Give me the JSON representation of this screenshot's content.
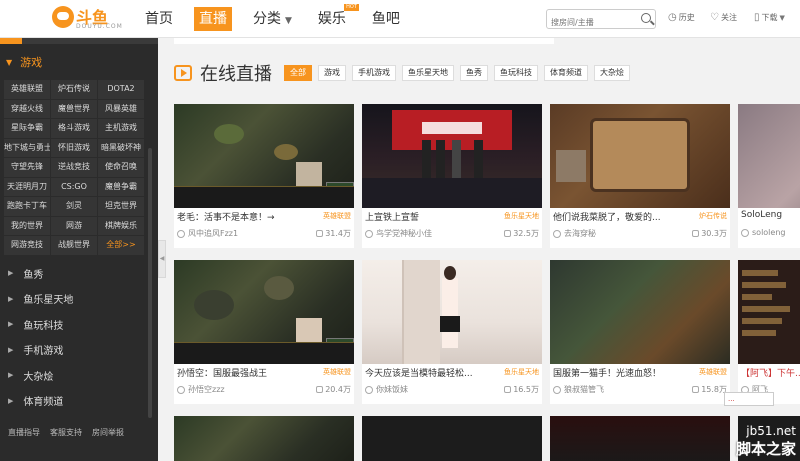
{
  "logo": {
    "brand": "斗鱼",
    "sub": "DOUYU.COM"
  },
  "nav": {
    "items": [
      {
        "label": "首页",
        "active": false
      },
      {
        "label": "直播",
        "active": true
      },
      {
        "label": "分类",
        "active": false,
        "has_caret": true
      },
      {
        "label": "娱乐",
        "active": false,
        "badge": "HOT"
      },
      {
        "label": "鱼吧",
        "active": false
      }
    ]
  },
  "search": {
    "placeholder": "搜房间/主播"
  },
  "header_utils": {
    "history": "历史",
    "follow": "关注",
    "download": "下载"
  },
  "sidebar": {
    "games_label": "游戏",
    "games": [
      "英雄联盟",
      "炉石传说",
      "DOTA2",
      "穿越火线",
      "魔兽世界",
      "风暴英雄",
      "星际争霸",
      "格斗游戏",
      "主机游戏",
      "地下城与勇士",
      "怀旧游戏",
      "暗黑破坏神",
      "守望先锋",
      "逆战竞技",
      "使命召唤",
      "天涯明月刀",
      "CS:GO",
      "魔兽争霸",
      "跑跑卡丁车",
      "剑灵",
      "坦克世界",
      "我的世界",
      "网游",
      "棋牌娱乐",
      "网游竞技",
      "战舰世界",
      "全部>>"
    ],
    "categories": [
      "鱼秀",
      "鱼乐星天地",
      "鱼玩科技",
      "手机游戏",
      "大杂烩",
      "体育频道"
    ],
    "footer": [
      "直播指导",
      "客服支持",
      "房间举报"
    ]
  },
  "main": {
    "section_title": "在线直播",
    "tags": [
      {
        "label": "全部",
        "active": true
      },
      {
        "label": "游戏",
        "active": false
      },
      {
        "label": "手机游戏",
        "active": false
      },
      {
        "label": "鱼乐星天地",
        "active": false
      },
      {
        "label": "鱼秀",
        "active": false
      },
      {
        "label": "鱼玩科技",
        "active": false
      },
      {
        "label": "体育频道",
        "active": false
      },
      {
        "label": "大杂烩",
        "active": false
      }
    ],
    "cards": [
      {
        "title": "老毛：活事不是本意！→",
        "category": "英雄联盟",
        "anchor": "风中追风Fzz1",
        "viewers": "31.4万"
      },
      {
        "title": "上宣铁上宣誓",
        "category": "鱼乐星天地",
        "anchor": "鸟学党神秘小佳",
        "viewers": "32.5万"
      },
      {
        "title": "他们说我菜脱了，敬爱的...",
        "category": "炉石传说",
        "anchor": "去海穿秘",
        "viewers": "30.3万"
      },
      {
        "title": "SoloLeng",
        "category": "",
        "anchor": "sololeng",
        "viewers": ""
      },
      {
        "title": "孙悟空：国服最强战王",
        "category": "英雄联盟",
        "anchor": "孙悟空zzz",
        "viewers": "20.4万"
      },
      {
        "title": "今天应该是当模特最轻松...",
        "category": "鱼乐星天地",
        "anchor": "你妹饭妹",
        "viewers": "16.5万"
      },
      {
        "title": "国服第一猫手！光速血怒！",
        "category": "英雄联盟",
        "anchor": "狼叔猫管飞",
        "viewers": "15.8万"
      },
      {
        "title": "【阿飞】下午...",
        "category": "",
        "anchor": "阿飞",
        "viewers": ""
      }
    ]
  },
  "watermark": {
    "url": "jb51.net",
    "name": "脚本之家"
  },
  "float_link": "..."
}
